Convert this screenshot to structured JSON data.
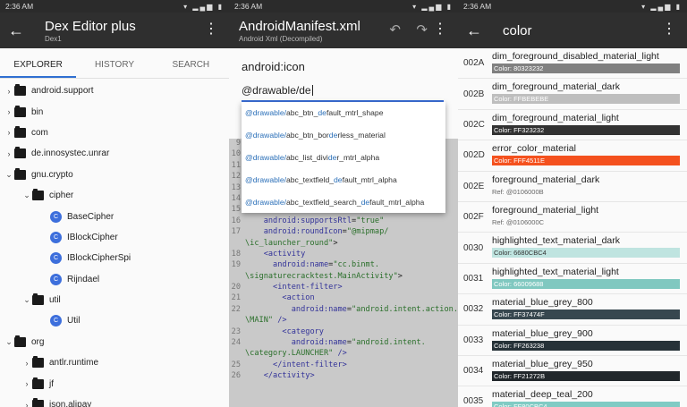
{
  "panel1": {
    "status_time": "2:36 AM",
    "title": "Dex Editor plus",
    "subtitle": "Dex1",
    "tabs": [
      "EXPLORER",
      "HISTORY",
      "SEARCH"
    ],
    "tree": [
      {
        "depth": 0,
        "kind": "folder",
        "expanded": false,
        "label": "android.support"
      },
      {
        "depth": 0,
        "kind": "folder",
        "expanded": false,
        "label": "bin"
      },
      {
        "depth": 0,
        "kind": "folder",
        "expanded": false,
        "label": "com"
      },
      {
        "depth": 0,
        "kind": "folder",
        "expanded": false,
        "label": "de.innosystec.unrar"
      },
      {
        "depth": 0,
        "kind": "folder",
        "expanded": true,
        "label": "gnu.crypto"
      },
      {
        "depth": 1,
        "kind": "folder",
        "expanded": true,
        "label": "cipher"
      },
      {
        "depth": 2,
        "kind": "class",
        "label": "BaseCipher"
      },
      {
        "depth": 2,
        "kind": "class",
        "label": "IBlockCipher"
      },
      {
        "depth": 2,
        "kind": "class",
        "label": "IBlockCipherSpi"
      },
      {
        "depth": 2,
        "kind": "class",
        "label": "Rijndael"
      },
      {
        "depth": 1,
        "kind": "folder",
        "expanded": true,
        "label": "util"
      },
      {
        "depth": 2,
        "kind": "class",
        "label": "Util"
      },
      {
        "depth": 0,
        "kind": "folder",
        "expanded": true,
        "label": "org"
      },
      {
        "depth": 1,
        "kind": "folder",
        "expanded": false,
        "label": "antlr.runtime"
      },
      {
        "depth": 1,
        "kind": "folder",
        "expanded": false,
        "label": "jf"
      },
      {
        "depth": 1,
        "kind": "folder",
        "expanded": false,
        "label": "json.alipay"
      }
    ]
  },
  "panel2": {
    "status_time": "2:36 AM",
    "title": "AndroidManifest.xml",
    "subtitle": "Android Xml (Decompiled)",
    "field_label": "android:icon",
    "input_value": "@drawable/de",
    "suggestions": [
      {
        "prefix": "@drawable/",
        "a": "abc_btn_",
        "hl": "de",
        "b": "fault_mtrl_shape"
      },
      {
        "prefix": "@drawable/",
        "a": "abc_btn_bor",
        "hl": "de",
        "b": "rless_material"
      },
      {
        "prefix": "@drawable/",
        "a": "abc_list_divi",
        "hl": "de",
        "b": "r_mtrl_alpha"
      },
      {
        "prefix": "@drawable/",
        "a": "abc_textfield_",
        "hl": "de",
        "b": "fault_mtrl_alpha"
      },
      {
        "prefix": "@drawable/",
        "a": "abc_textfield_search_",
        "hl": "de",
        "b": "fault_mtrl_alpha"
      }
    ],
    "code": [
      {
        "n": "9",
        "indent": "",
        "parts": []
      },
      {
        "n": "10",
        "indent": "",
        "parts": []
      },
      {
        "n": "11",
        "indent": "",
        "parts": []
      },
      {
        "n": "12",
        "indent": "",
        "parts": []
      },
      {
        "n": "13",
        "indent": "",
        "parts": []
      },
      {
        "n": "14",
        "indent": "    ",
        "parts": [
          {
            "t": "android:debuggable",
            "c": "attr"
          },
          {
            "t": "=",
            "c": "plain"
          },
          {
            "t": "\"true\"",
            "c": "val"
          }
        ]
      },
      {
        "n": "15",
        "indent": "    ",
        "parts": [
          {
            "t": "android:allowBackup",
            "c": "attr"
          },
          {
            "t": "=",
            "c": "plain"
          },
          {
            "t": "\"true\"",
            "c": "val"
          }
        ]
      },
      {
        "n": "16",
        "indent": "    ",
        "parts": [
          {
            "t": "android:supportsRtl",
            "c": "attr"
          },
          {
            "t": "=",
            "c": "plain"
          },
          {
            "t": "\"true\"",
            "c": "val"
          }
        ]
      },
      {
        "n": "17",
        "indent": "    ",
        "parts": [
          {
            "t": "android:roundIcon",
            "c": "attr"
          },
          {
            "t": "=",
            "c": "plain"
          },
          {
            "t": "\"@mipmap/",
            "c": "val"
          }
        ]
      },
      {
        "n": "",
        "indent": "",
        "parts": [
          {
            "t": "\\ic_launcher_round\"",
            "c": "val"
          },
          {
            "t": ">",
            "c": "plain"
          }
        ]
      },
      {
        "n": "18",
        "indent": "    ",
        "parts": [
          {
            "t": "<activity",
            "c": "tag"
          }
        ]
      },
      {
        "n": "19",
        "indent": "      ",
        "parts": [
          {
            "t": "android:name",
            "c": "attr"
          },
          {
            "t": "=",
            "c": "plain"
          },
          {
            "t": "\"cc.binmt.",
            "c": "val"
          }
        ]
      },
      {
        "n": "",
        "indent": "",
        "parts": [
          {
            "t": "\\signaturecracktest.MainActivity\"",
            "c": "val"
          },
          {
            "t": ">",
            "c": "plain"
          }
        ]
      },
      {
        "n": "20",
        "indent": "      ",
        "parts": [
          {
            "t": "<intent-filter>",
            "c": "tag"
          }
        ]
      },
      {
        "n": "21",
        "indent": "        ",
        "parts": [
          {
            "t": "<action",
            "c": "tag"
          }
        ]
      },
      {
        "n": "22",
        "indent": "          ",
        "parts": [
          {
            "t": "android:name",
            "c": "attr"
          },
          {
            "t": "=",
            "c": "plain"
          },
          {
            "t": "\"android.intent.action.",
            "c": "val"
          }
        ]
      },
      {
        "n": "",
        "indent": "",
        "parts": [
          {
            "t": "\\MAIN\"",
            "c": "val"
          },
          {
            "t": " />",
            "c": "tag"
          }
        ]
      },
      {
        "n": "23",
        "indent": "        ",
        "parts": [
          {
            "t": "<category",
            "c": "tag"
          }
        ]
      },
      {
        "n": "24",
        "indent": "          ",
        "parts": [
          {
            "t": "android:name",
            "c": "attr"
          },
          {
            "t": "=",
            "c": "plain"
          },
          {
            "t": "\"android.intent.",
            "c": "val"
          }
        ]
      },
      {
        "n": "",
        "indent": "",
        "parts": [
          {
            "t": "\\category.LAUNCHER\"",
            "c": "val"
          },
          {
            "t": " />",
            "c": "tag"
          }
        ]
      },
      {
        "n": "25",
        "indent": "      ",
        "parts": [
          {
            "t": "</intent-filter>",
            "c": "tag"
          }
        ]
      },
      {
        "n": "26",
        "indent": "    ",
        "parts": [
          {
            "t": "</activity>",
            "c": "tag"
          }
        ]
      }
    ]
  },
  "panel3": {
    "status_time": "2:36 AM",
    "title": "color",
    "rows": [
      {
        "id": "002A",
        "name": "dim_foreground_disabled_material_light",
        "color": "#808080",
        "label": "Color: 80323232",
        "text_light": true
      },
      {
        "id": "002B",
        "name": "dim_foreground_material_dark",
        "color": "#bebebe",
        "label": "Color: FFBEBEBE",
        "text_light": true
      },
      {
        "id": "002C",
        "name": "dim_foreground_material_light",
        "color": "#323232",
        "label": "Color: FF323232",
        "text_light": true
      },
      {
        "id": "002D",
        "name": "error_color_material",
        "color": "#f4511e",
        "label": "Color: FFF4511E",
        "text_light": true
      },
      {
        "id": "002E",
        "name": "foreground_material_dark",
        "ref": "Ref: @0106000B"
      },
      {
        "id": "002F",
        "name": "foreground_material_light",
        "ref": "Ref: @0106000C"
      },
      {
        "id": "0030",
        "name": "highlighted_text_material_dark",
        "color": "#bfe4e0",
        "label": "Color: 6680CBC4",
        "text_light": false
      },
      {
        "id": "0031",
        "name": "highlighted_text_material_light",
        "color": "#80c8c0",
        "label": "Color: 66009688",
        "text_light": true
      },
      {
        "id": "0032",
        "name": "material_blue_grey_800",
        "color": "#37474f",
        "label": "Color: FF37474F",
        "text_light": true
      },
      {
        "id": "0033",
        "name": "material_blue_grey_900",
        "color": "#263238",
        "label": "Color: FF263238",
        "text_light": true
      },
      {
        "id": "0034",
        "name": "material_blue_grey_950",
        "color": "#21272b",
        "label": "Color: FF21272B",
        "text_light": true
      },
      {
        "id": "0035",
        "name": "material_deep_teal_200",
        "color": "#80cbc4",
        "label": "Color: FF80CBC4",
        "text_light": true
      }
    ]
  }
}
